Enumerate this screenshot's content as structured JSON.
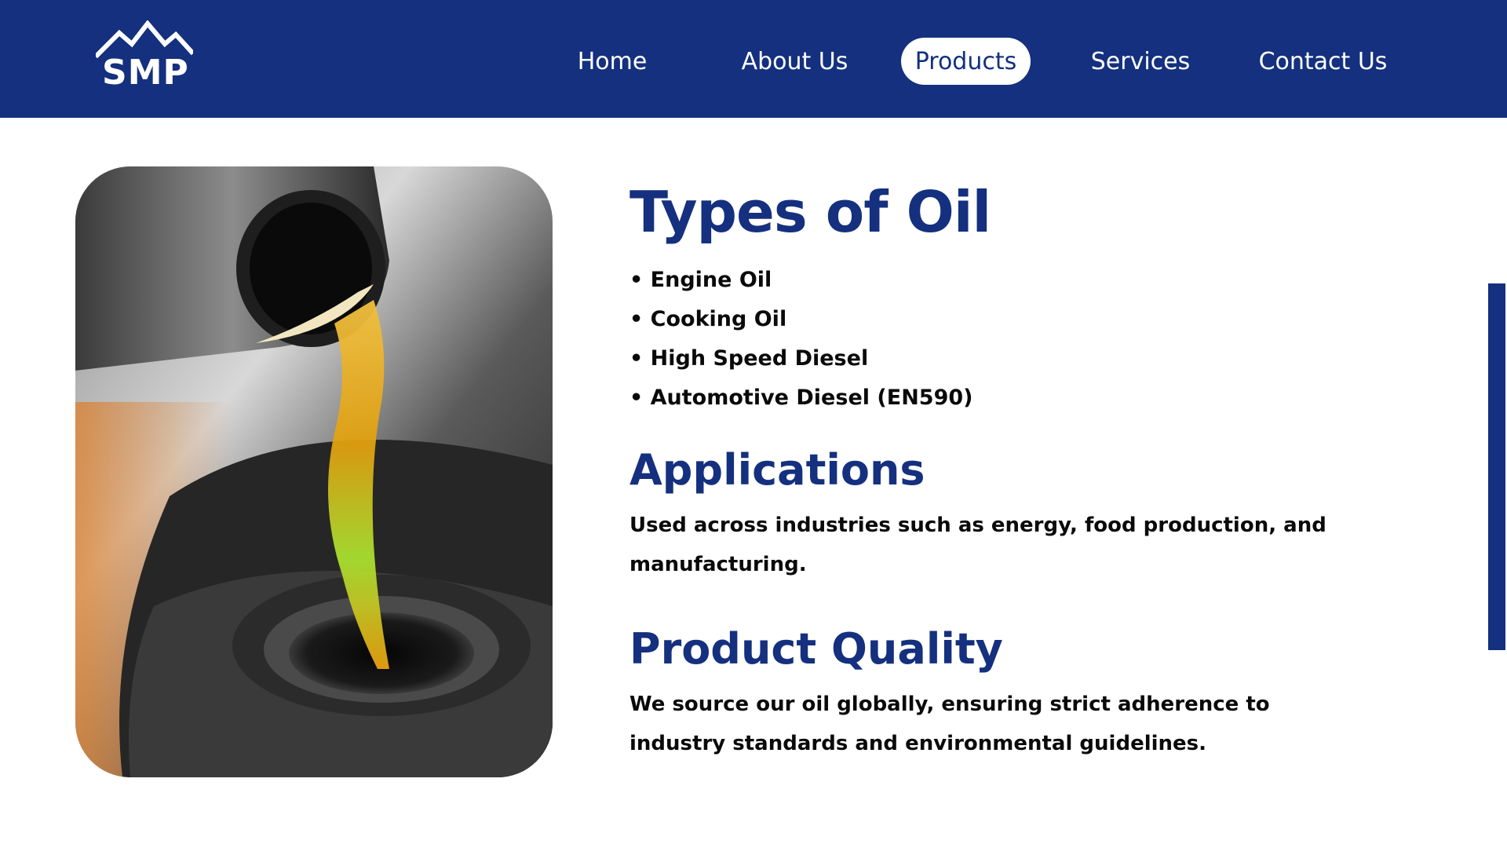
{
  "header": {
    "logo_text": "SMP",
    "nav": {
      "home": "Home",
      "about": "About Us",
      "products": "Products",
      "services": "Services",
      "contact": "Contact Us"
    },
    "active_nav": "products"
  },
  "main": {
    "title": "Types of Oil",
    "oil_types": [
      "• Engine Oil",
      "• Cooking Oil",
      "• High Speed Diesel",
      "• Automotive Diesel (EN590)"
    ],
    "applications": {
      "heading": "Applications",
      "text": "Used across industries such as energy, food production, and manufacturing."
    },
    "quality": {
      "heading": "Product Quality",
      "text": "We source our oil globally, ensuring strict adherence to industry standards and environmental guidelines."
    }
  },
  "colors": {
    "brand_navy": "#14307e",
    "background": "#ffffff",
    "body_text": "#0a0a0a"
  }
}
